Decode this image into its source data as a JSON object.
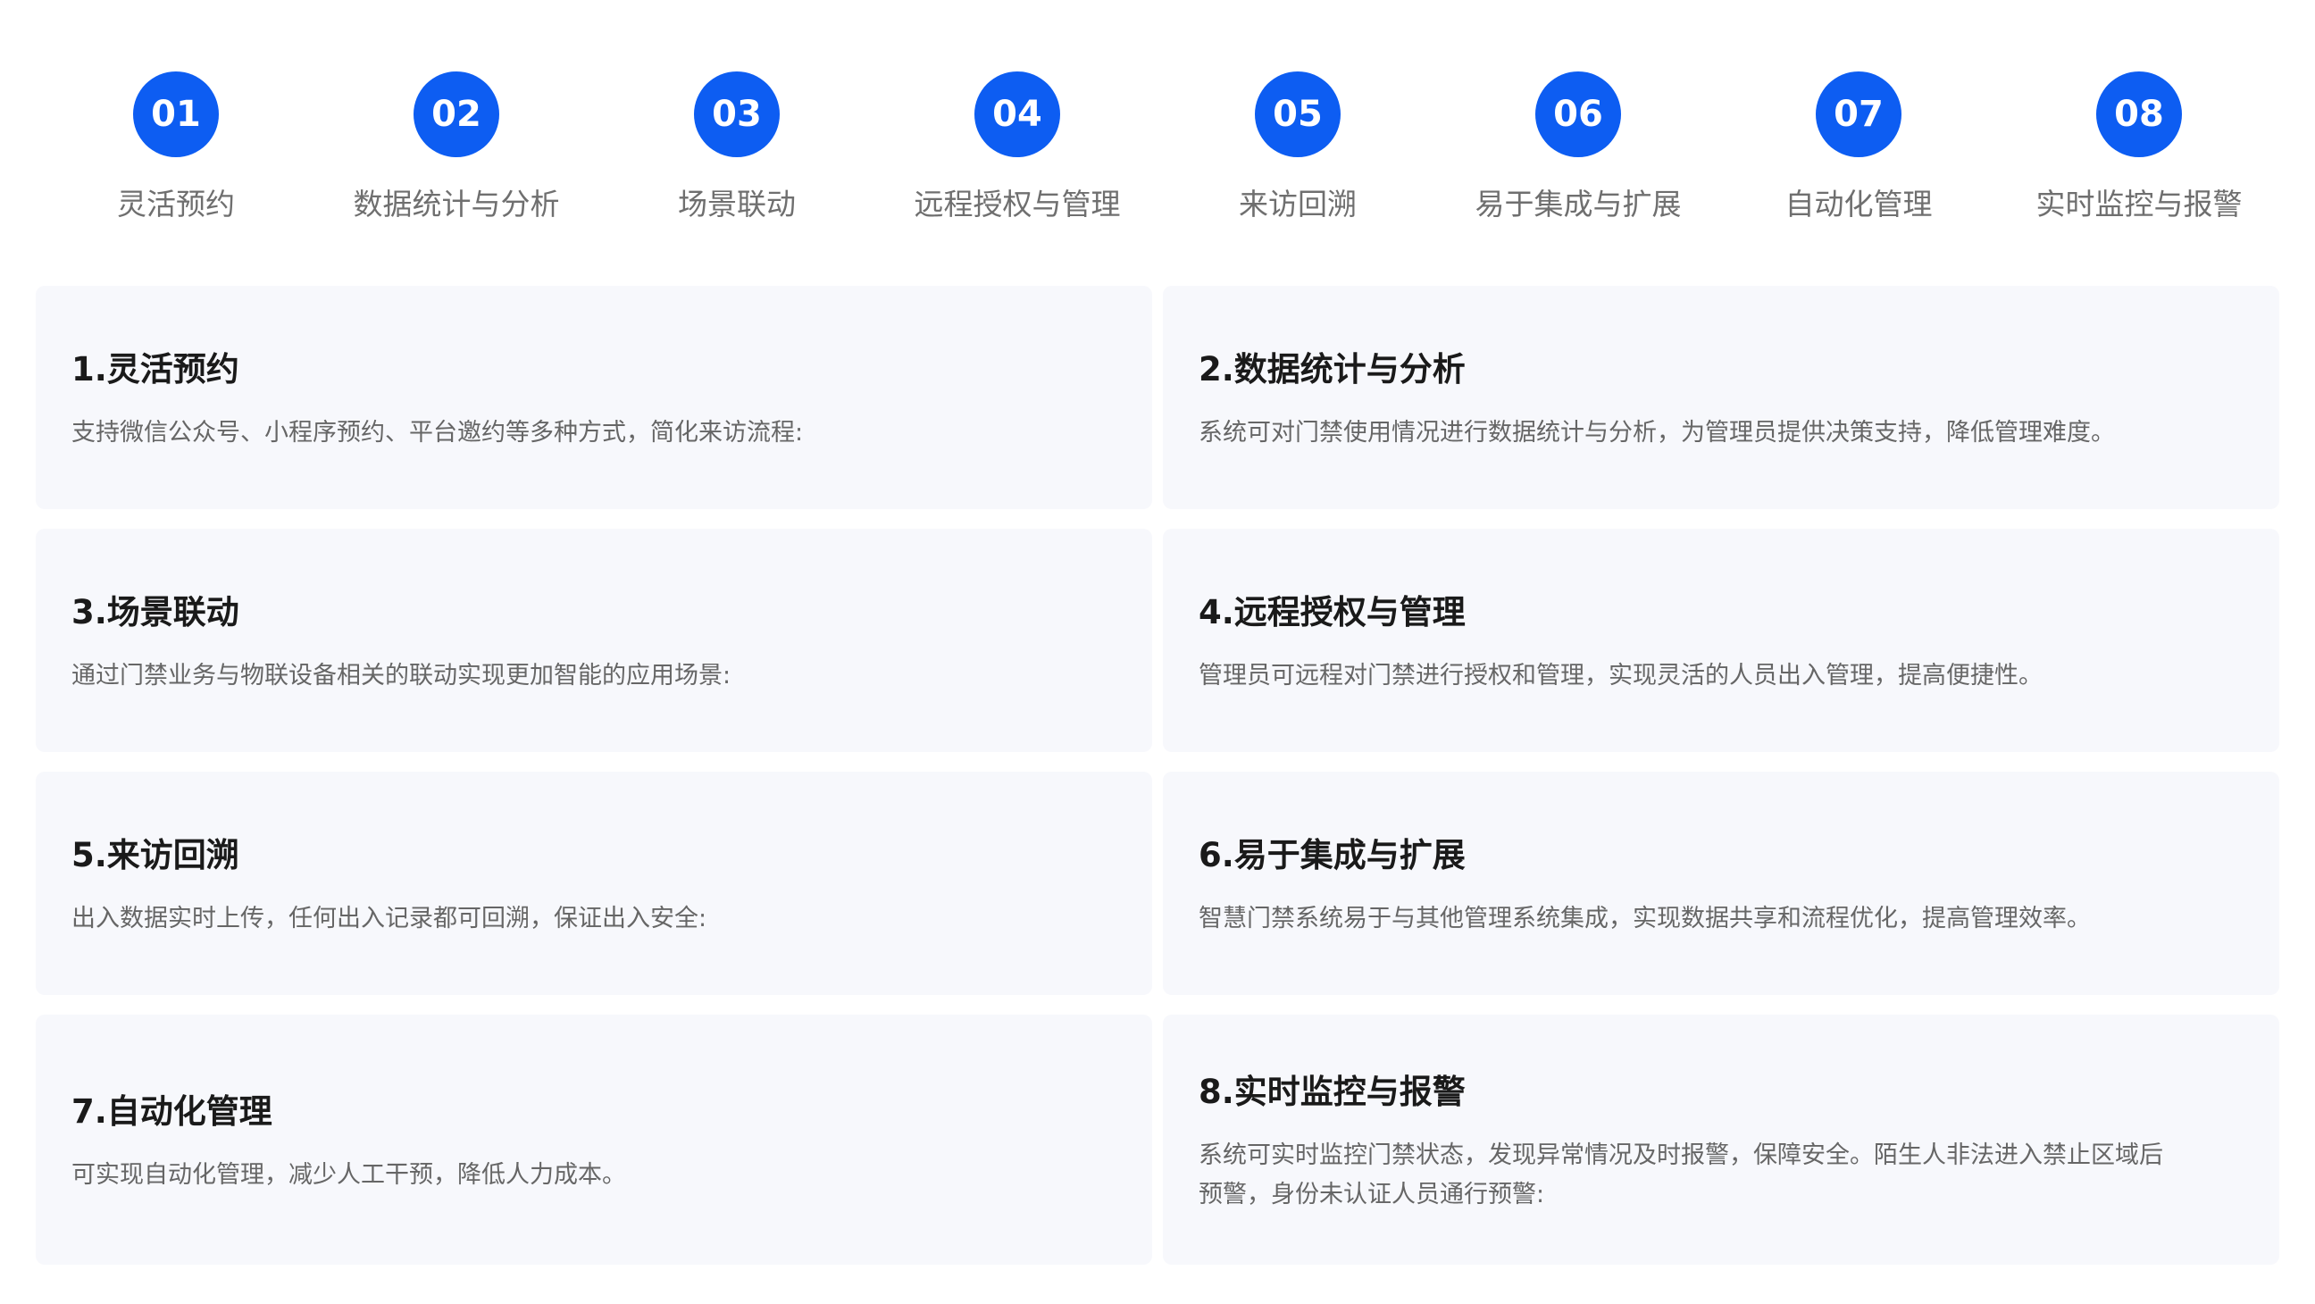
{
  "steps": [
    {
      "number": "01",
      "label": "灵活预约"
    },
    {
      "number": "02",
      "label": "数据统计与分析"
    },
    {
      "number": "03",
      "label": "场景联动"
    },
    {
      "number": "04",
      "label": "远程授权与管理"
    },
    {
      "number": "05",
      "label": "来访回溯"
    },
    {
      "number": "06",
      "label": "易于集成与扩展"
    },
    {
      "number": "07",
      "label": "自动化管理"
    },
    {
      "number": "08",
      "label": "实时监控与报警"
    }
  ],
  "cards": [
    {
      "title": "1.灵活预约",
      "desc": "支持微信公众号、小程序预约、平台邀约等多种方式，简化来访流程:"
    },
    {
      "title": "2.数据统计与分析",
      "desc": "系统可对门禁使用情况进行数据统计与分析，为管理员提供决策支持，降低管理难度。"
    },
    {
      "title": "3.场景联动",
      "desc": "通过门禁业务与物联设备相关的联动实现更加智能的应用场景:"
    },
    {
      "title": "4.远程授权与管理",
      "desc": "管理员可远程对门禁进行授权和管理，实现灵活的人员出入管理，提高便捷性。"
    },
    {
      "title": "5.来访回溯",
      "desc": "出入数据实时上传，任何出入记录都可回溯，保证出入安全:"
    },
    {
      "title": "6.易于集成与扩展",
      "desc": "智慧门禁系统易于与其他管理系统集成，实现数据共享和流程优化，提高管理效率。"
    },
    {
      "title": "7.自动化管理",
      "desc": "可实现自动化管理，减少人工干预，降低人力成本。"
    },
    {
      "title": "8.实时监控与报警",
      "desc": "系统可实时监控门禁状态，发现异常情况及时报警，保障安全。陌生人非法进入禁止区域后预警，身份未认证人员通行预警:"
    }
  ],
  "colors": {
    "accent": "#0d5df2",
    "card_background": "#f7f8fc",
    "label_text": "#6f6f6f",
    "title_text": "#1a1a1a",
    "desc_text": "#666666"
  }
}
